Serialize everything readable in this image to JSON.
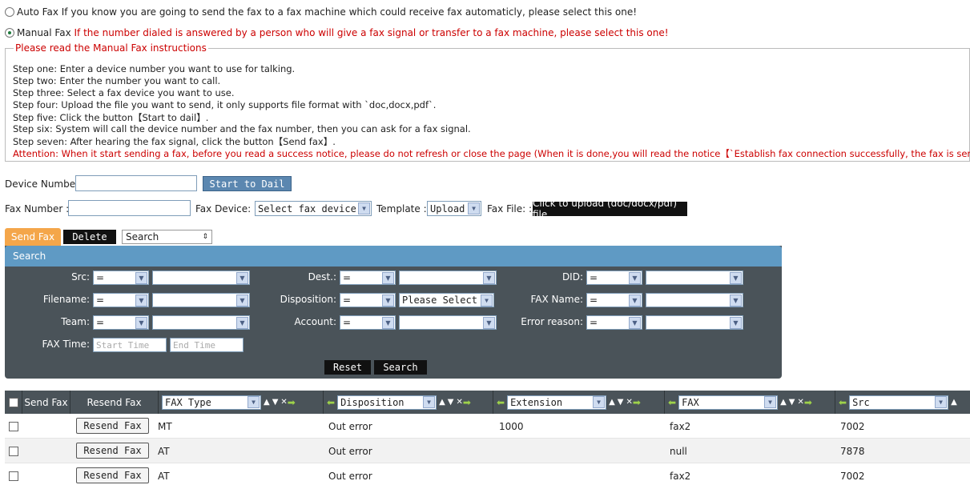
{
  "mode": {
    "auto": {
      "label": "Auto Fax",
      "desc": "If you know you are going to send the fax to a fax machine which could receive fax automaticly, please select this one!",
      "selected": false
    },
    "manual": {
      "label": "Manual Fax",
      "desc": "If the number dialed is answered by a person who will give a fax signal or transfer to a fax machine, please select this one!",
      "selected": true
    }
  },
  "instructions": {
    "legend": "Please read the Manual Fax instructions",
    "steps": [
      "Step one: Enter a device number you want to use for talking.",
      "Step two: Enter the number you want to call.",
      "Step three: Select a fax device you want to use.",
      "Step four: Upload the file you want to send, it only supports file format with `doc,docx,pdf`.",
      "Step five: Click the button【Start to dail】.",
      "Step six: System will call the device number and the fax number, then you can ask for a fax signal.",
      "Step seven: After hearing the fax signal, click the button【Send fax】."
    ],
    "attention": "Attention: When it start sending a fax, before you read a success notice, please do not refresh or close the page (When it is done,you will read the notice【`Establish fax connection successfully, the fax is sending`】)."
  },
  "form": {
    "device_label": "Device Number:",
    "device_value": "",
    "start_button": "Start to Dail",
    "fax_number_label": "Fax Number :",
    "fax_number_value": "",
    "fax_device_label": "Fax Device: :",
    "fax_device_selected": "Select fax device",
    "template_label": "Template :",
    "template_selected": "Upload",
    "fax_file_label": "Fax File: :",
    "upload_button": "Click to upload (doc/docx/pdf) file"
  },
  "toolbar": {
    "send_fax_tab": "Send Fax",
    "delete_button": "Delete",
    "search_dropdown": "Search"
  },
  "search_panel": {
    "title": "Search",
    "src_label": "Src:",
    "dest_label": "Dest.:",
    "did_label": "DID:",
    "filename_label": "Filename:",
    "disposition_label": "Disposition:",
    "fax_name_label": "FAX Name:",
    "team_label": "Team:",
    "account_label": "Account:",
    "error_reason_label": "Error reason:",
    "fax_time_label": "FAX Time:",
    "operator": "=",
    "disposition_value": "Please Select",
    "start_time_placeholder": "Start Time",
    "end_time_placeholder": "End Time",
    "reset_button": "Reset",
    "search_button": "Search"
  },
  "grid": {
    "headers": {
      "send_fax": "Send Fax",
      "resend_fax": "Resend Fax",
      "fax_type": "FAX Type",
      "disposition": "Disposition",
      "extension": "Extension",
      "fax": "FAX",
      "src": "Src"
    },
    "resend_label": "Resend Fax",
    "rows": [
      {
        "fax_type": "MT",
        "disposition": "Out error",
        "extension": "1000",
        "fax": "fax2",
        "src": "7002"
      },
      {
        "fax_type": "AT",
        "disposition": "Out error",
        "extension": "",
        "fax": "null",
        "src": "7878"
      },
      {
        "fax_type": "AT",
        "disposition": "Out error",
        "extension": "",
        "fax": "fax2",
        "src": "7002"
      }
    ]
  },
  "colors": {
    "accent_orange": "#f4a64a",
    "panel_dark": "#4a5359",
    "panel_head_blue": "#5f9ac4",
    "button_blue": "#5b87b0",
    "warning_red": "#cc0000"
  }
}
